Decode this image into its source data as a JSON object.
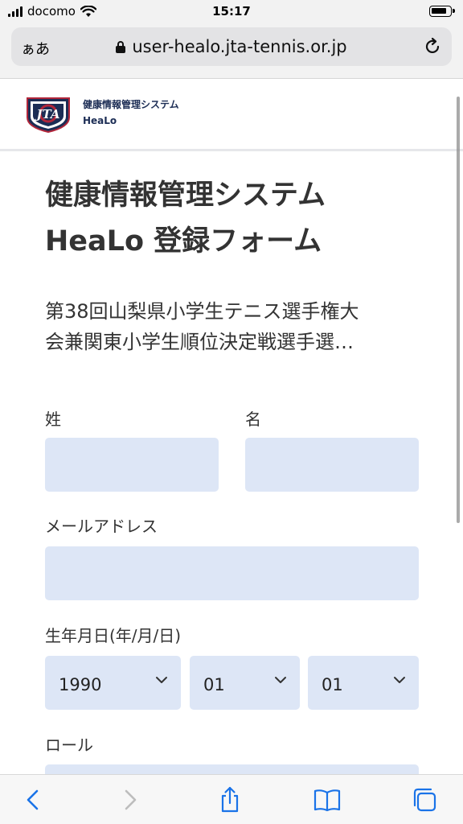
{
  "status_bar": {
    "carrier": "docomo",
    "time": "15:17"
  },
  "browser": {
    "text_size_label": "ぁあ",
    "url": "user-healo.jta-tennis.or.jp"
  },
  "site_header": {
    "brand_line1": "健康情報管理システム",
    "brand_line2": "HeaLo",
    "logo_text": "JTA"
  },
  "form": {
    "title_line1": "健康情報管理システム",
    "title_line2": "HeaLo 登録フォーム",
    "subtitle_line1": "第38回山梨県小学生テニス選手権大",
    "subtitle_line2": "会兼関東小学生順位決定戦選手選…",
    "last_name_label": "姓",
    "first_name_label": "名",
    "email_label": "メールアドレス",
    "birthdate_label": "生年月日(年/月/日)",
    "birth_year": "1990",
    "birth_month": "01",
    "birth_day": "01",
    "role_label": "ロール"
  },
  "colors": {
    "field_bg": "#dde6f6",
    "brand_navy": "#1c2d55",
    "ios_blue": "#1a73e8"
  }
}
